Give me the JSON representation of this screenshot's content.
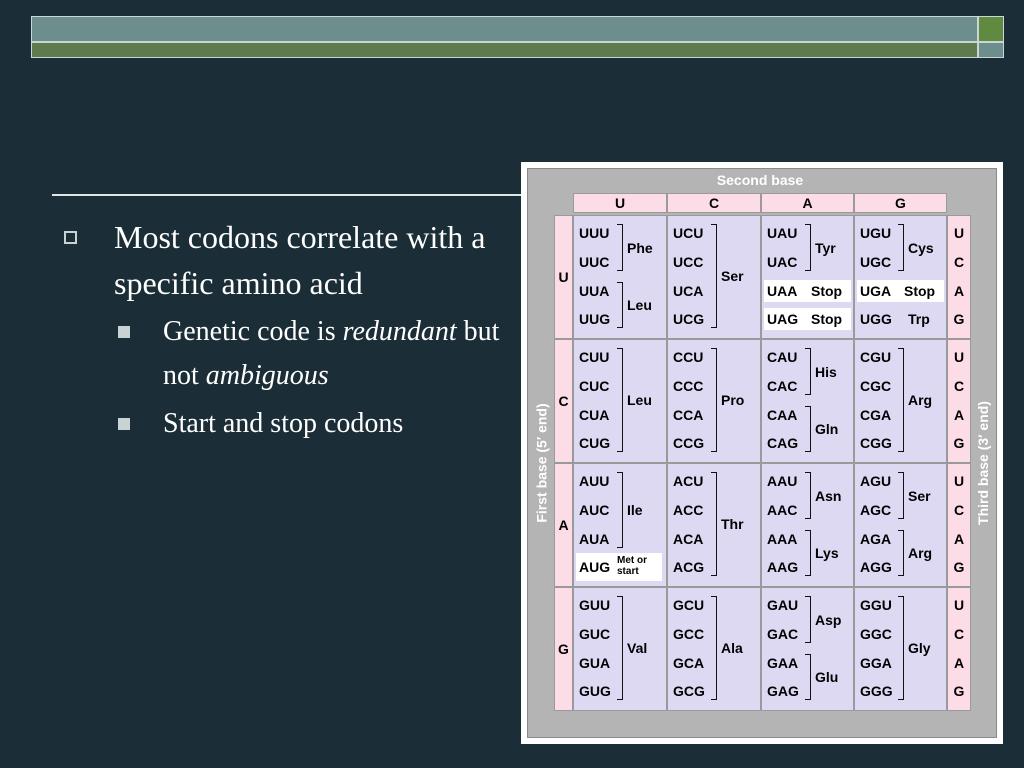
{
  "slide": {
    "bullet_main": "Most codons correlate with a specific amino acid",
    "sub1_prefix": "Genetic code is",
    "sub1_em1": "redundant",
    "sub1_mid": "but not",
    "sub1_em2": "ambiguous",
    "sub2": "Start and stop codons"
  },
  "codon_table": {
    "second_base_title": "Second base",
    "first_base_title": "First base  (5′ end)",
    "third_base_title": "Third base  (3′ end)",
    "bases": [
      "U",
      "C",
      "A",
      "G"
    ],
    "rows": [
      {
        "first": "U",
        "third": [
          "U",
          "C",
          "A",
          "G"
        ],
        "cols": [
          {
            "codons": [
              "UUU",
              "UUC",
              "UUA",
              "UUG"
            ],
            "aa1": "Phe",
            "aa2": "Leu"
          },
          {
            "codons": [
              "UCU",
              "UCC",
              "UCA",
              "UCG"
            ],
            "aa1": "Ser"
          },
          {
            "codons": [
              "UAU",
              "UAC",
              "UAA",
              "UAG"
            ],
            "aa1": "Tyr",
            "stop1": "Stop",
            "stop2": "Stop"
          },
          {
            "codons": [
              "UGU",
              "UGC",
              "UGA",
              "UGG"
            ],
            "aa1": "Cys",
            "stop1": "Stop",
            "trp": "Trp"
          }
        ]
      },
      {
        "first": "C",
        "third": [
          "U",
          "C",
          "A",
          "G"
        ],
        "cols": [
          {
            "codons": [
              "CUU",
              "CUC",
              "CUA",
              "CUG"
            ],
            "aa1": "Leu"
          },
          {
            "codons": [
              "CCU",
              "CCC",
              "CCA",
              "CCG"
            ],
            "aa1": "Pro"
          },
          {
            "codons": [
              "CAU",
              "CAC",
              "CAA",
              "CAG"
            ],
            "aa1": "His",
            "aa2": "Gln"
          },
          {
            "codons": [
              "CGU",
              "CGC",
              "CGA",
              "CGG"
            ],
            "aa1": "Arg"
          }
        ]
      },
      {
        "first": "A",
        "third": [
          "U",
          "C",
          "A",
          "G"
        ],
        "cols": [
          {
            "codons": [
              "AUU",
              "AUC",
              "AUA",
              "AUG"
            ],
            "aa1": "Ile",
            "met1": "Met or",
            "met2": "start"
          },
          {
            "codons": [
              "ACU",
              "ACC",
              "ACA",
              "ACG"
            ],
            "aa1": "Thr"
          },
          {
            "codons": [
              "AAU",
              "AAC",
              "AAA",
              "AAG"
            ],
            "aa1": "Asn",
            "aa2": "Lys"
          },
          {
            "codons": [
              "AGU",
              "AGC",
              "AGA",
              "AGG"
            ],
            "aa1": "Ser",
            "aa2": "Arg"
          }
        ]
      },
      {
        "first": "G",
        "third": [
          "U",
          "C",
          "A",
          "G"
        ],
        "cols": [
          {
            "codons": [
              "GUU",
              "GUC",
              "GUA",
              "GUG"
            ],
            "aa1": "Val"
          },
          {
            "codons": [
              "GCU",
              "GCC",
              "GCA",
              "GCG"
            ],
            "aa1": "Ala"
          },
          {
            "codons": [
              "GAU",
              "GAC",
              "GAA",
              "GAG"
            ],
            "aa1": "Asp",
            "aa2": "Glu"
          },
          {
            "codons": [
              "GGU",
              "GGC",
              "GGA",
              "GGG"
            ],
            "aa1": "Gly"
          }
        ]
      }
    ]
  }
}
